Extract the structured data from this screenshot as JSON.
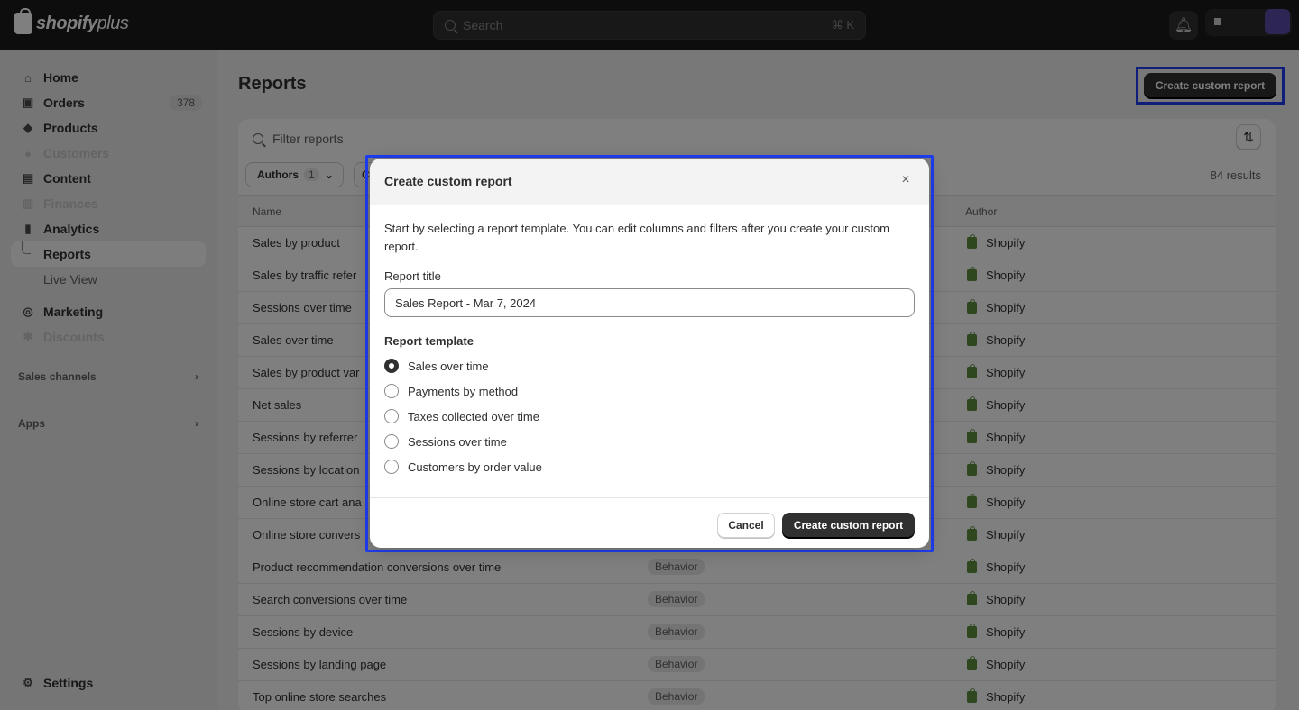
{
  "topbar": {
    "brand": "shopify",
    "brand_suffix": "plus",
    "search_placeholder": "Search",
    "search_shortcut": "⌘ K"
  },
  "sidebar": {
    "items": [
      {
        "label": "Home",
        "icon": "home-icon"
      },
      {
        "label": "Orders",
        "icon": "orders-icon",
        "count": "378"
      },
      {
        "label": "Products",
        "icon": "tag-icon"
      },
      {
        "label": "Customers",
        "icon": "person-icon"
      },
      {
        "label": "Content",
        "icon": "content-icon"
      },
      {
        "label": "Finances",
        "icon": "bank-icon"
      },
      {
        "label": "Analytics",
        "icon": "chart-icon"
      },
      {
        "label": "Reports"
      },
      {
        "label": "Live View"
      },
      {
        "label": "Marketing",
        "icon": "target-icon"
      },
      {
        "label": "Discounts",
        "icon": "discount-icon"
      }
    ],
    "sections": [
      "Sales channels",
      "Apps"
    ],
    "settings": "Settings"
  },
  "page": {
    "title": "Reports",
    "create_button": "Create custom report",
    "filter_placeholder": "Filter reports",
    "authors_chip": "Authors",
    "authors_count": "1",
    "second_chip": "C",
    "results": "84 results",
    "columns": {
      "name": "Name",
      "author": "Author"
    }
  },
  "rows": [
    {
      "name": "Sales by product",
      "category": "",
      "author": "Shopify"
    },
    {
      "name": "Sales by traffic refer",
      "category": "",
      "author": "Shopify"
    },
    {
      "name": "Sessions over time",
      "category": "",
      "author": "Shopify"
    },
    {
      "name": "Sales over time",
      "category": "",
      "author": "Shopify"
    },
    {
      "name": "Sales by product var",
      "category": "",
      "author": "Shopify"
    },
    {
      "name": "Net sales",
      "category": "",
      "author": "Shopify"
    },
    {
      "name": "Sessions by referrer",
      "category": "",
      "author": "Shopify"
    },
    {
      "name": "Sessions by location",
      "category": "",
      "author": "Shopify"
    },
    {
      "name": "Online store cart ana",
      "category": "",
      "author": "Shopify"
    },
    {
      "name": "Online store convers",
      "category": "",
      "author": "Shopify"
    },
    {
      "name": "Product recommendation conversions over time",
      "category": "Behavior",
      "author": "Shopify"
    },
    {
      "name": "Search conversions over time",
      "category": "Behavior",
      "author": "Shopify"
    },
    {
      "name": "Sessions by device",
      "category": "Behavior",
      "author": "Shopify"
    },
    {
      "name": "Sessions by landing page",
      "category": "Behavior",
      "author": "Shopify"
    },
    {
      "name": "Top online store searches",
      "category": "Behavior",
      "author": "Shopify"
    }
  ],
  "modal": {
    "title": "Create custom report",
    "close": "×",
    "description": "Start by selecting a report template. You can edit columns and filters after you create your custom report.",
    "title_label": "Report title",
    "title_value": "Sales Report - Mar 7, 2024",
    "template_label": "Report template",
    "templates": [
      {
        "label": "Sales over time",
        "selected": true
      },
      {
        "label": "Payments by method",
        "selected": false
      },
      {
        "label": "Taxes collected over time",
        "selected": false
      },
      {
        "label": "Sessions over time",
        "selected": false
      },
      {
        "label": "Customers by order value",
        "selected": false
      }
    ],
    "cancel": "Cancel",
    "submit": "Create custom report"
  },
  "colors": {
    "highlight": "#1f3df2",
    "primary_button": "#303030",
    "shopify_green": "#5e8e3e"
  }
}
